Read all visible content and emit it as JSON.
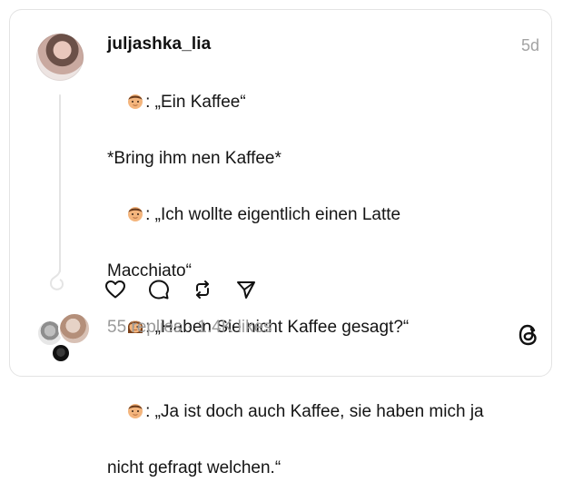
{
  "post": {
    "username": "juljashka_lia",
    "time": "5d",
    "lines": [
      {
        "emoji": "man-emoji",
        "text": ": „Ein Kaffee“"
      },
      {
        "emoji": "",
        "text": "*Bring ihm nen Kaffee*"
      },
      {
        "emoji": "man-emoji",
        "text": ": „Ich wollte eigentlich einen Latte"
      },
      {
        "emoji": "",
        "text": "Macchiato“"
      },
      {
        "emoji": "woman-emoji",
        "text": ": „Haben Sie nicht Kaffee gesagt?“"
      },
      {
        "emoji": "man-emoji",
        "text": ": „Ja ist doch auch Kaffee, sie haben mich ja"
      },
      {
        "emoji": "",
        "text": "nicht gefragt welchen.“"
      }
    ]
  },
  "actions": {
    "icons": [
      "heart-icon",
      "comment-icon",
      "repost-icon",
      "share-icon"
    ]
  },
  "stats": {
    "replies": "55 replies",
    "separator": " · ",
    "likes": "1.4K likes"
  },
  "colors": {
    "text": "#141414",
    "muted": "#9a9a9a",
    "border": "#e3e3e3"
  }
}
